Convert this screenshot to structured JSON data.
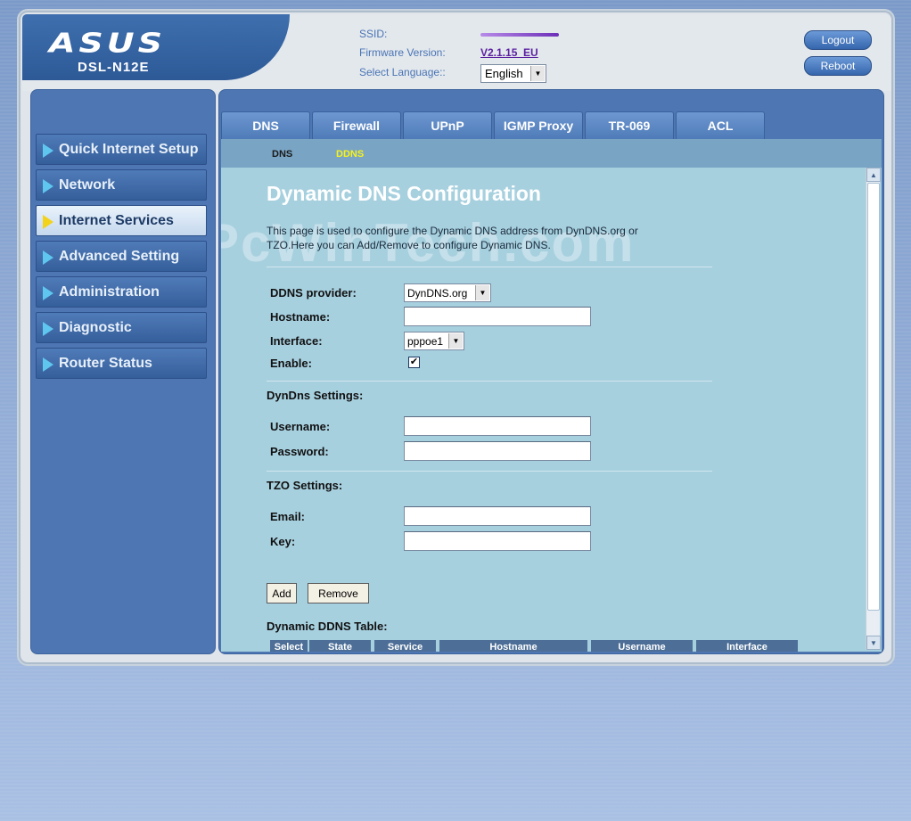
{
  "header": {
    "brand": "ASUS",
    "model": "DSL-N12E",
    "ssid_label": "SSID:",
    "firmware_label": "Firmware Version:",
    "firmware_value": "V2.1.15_EU",
    "language_label": "Select Language::",
    "language_value": "English",
    "logout_label": "Logout",
    "reboot_label": "Reboot"
  },
  "sidebar": {
    "items": [
      {
        "label": "Quick Internet Setup",
        "active": false
      },
      {
        "label": "Network",
        "active": false
      },
      {
        "label": "Internet Services",
        "active": true
      },
      {
        "label": "Advanced Setting",
        "active": false
      },
      {
        "label": "Administration",
        "active": false
      },
      {
        "label": "Diagnostic",
        "active": false
      },
      {
        "label": "Router Status",
        "active": false
      }
    ]
  },
  "tabs": [
    "DNS",
    "Firewall",
    "UPnP",
    "IGMP Proxy",
    "TR-069",
    "ACL"
  ],
  "subnav": {
    "items": [
      "DNS",
      "DDNS"
    ],
    "active": "DDNS"
  },
  "content": {
    "title": "Dynamic DNS Configuration",
    "description": "This page is used to configure the Dynamic DNS address from DynDNS.org or TZO.Here you can Add/Remove to configure Dynamic DNS.",
    "watermark": "PcWinTech.com",
    "form": {
      "provider_label": "DDNS provider:",
      "provider_value": "DynDNS.org",
      "hostname_label": "Hostname:",
      "interface_label": "Interface:",
      "interface_value": "pppoe1",
      "enable_label": "Enable:",
      "enable_checked": true
    },
    "dyndns": {
      "heading": "DynDns Settings:",
      "username_label": "Username:",
      "password_label": "Password:"
    },
    "tzo": {
      "heading": "TZO Settings:",
      "email_label": "Email:",
      "key_label": "Key:"
    },
    "buttons": {
      "add": "Add",
      "remove": "Remove"
    },
    "table": {
      "heading": "Dynamic DDNS Table:",
      "columns": [
        "Select",
        "State",
        "Service",
        "Hostname",
        "Username",
        "Interface"
      ]
    }
  }
}
